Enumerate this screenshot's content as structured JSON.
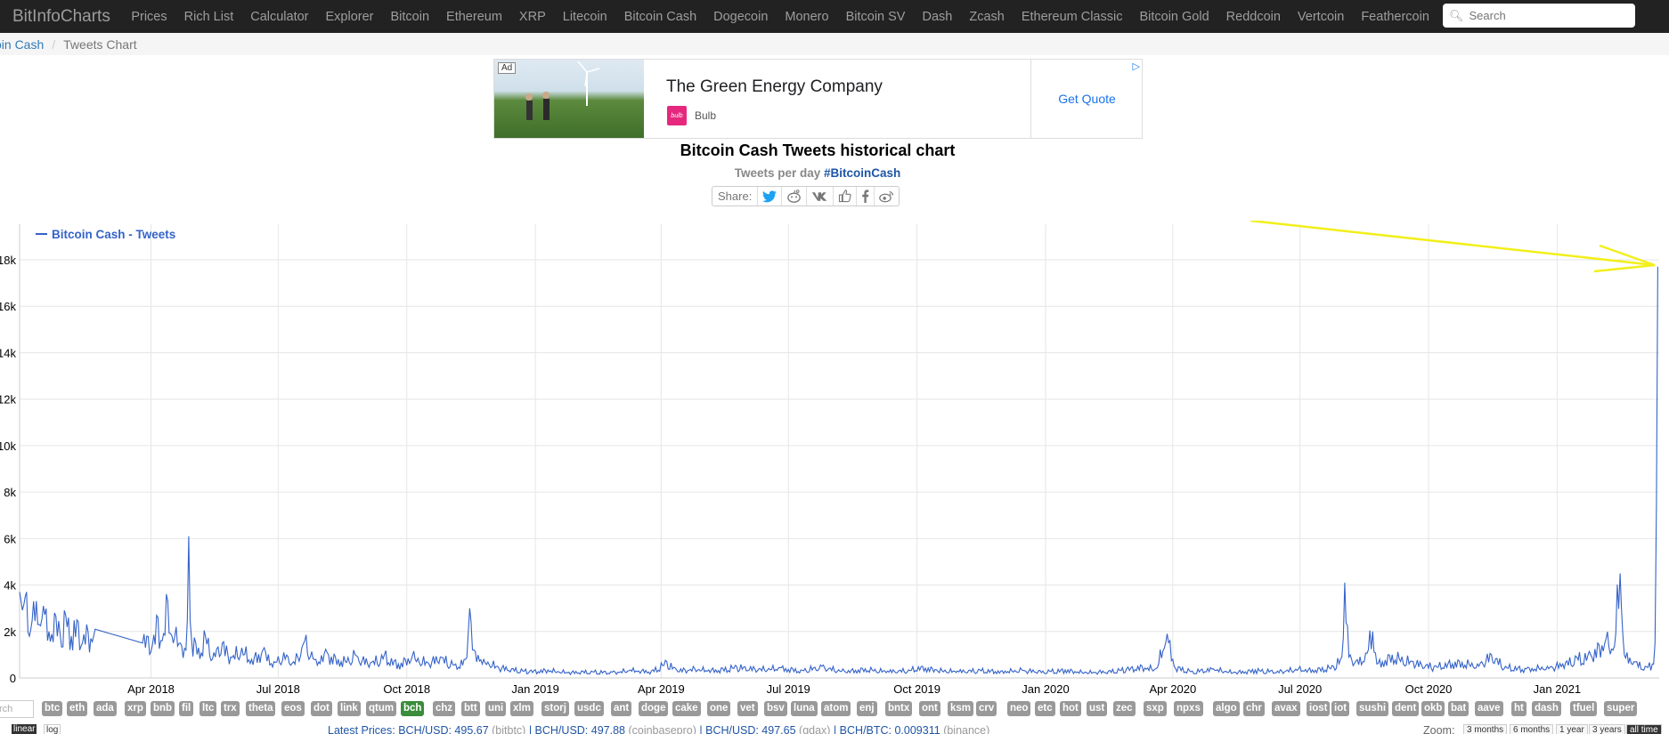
{
  "navbar": {
    "brand": "BitInfoCharts",
    "items": [
      "Prices",
      "Rich List",
      "Calculator",
      "Explorer",
      "Bitcoin",
      "Ethereum",
      "XRP",
      "Litecoin",
      "Bitcoin Cash",
      "Dogecoin",
      "Monero",
      "Bitcoin SV",
      "Dash",
      "Zcash",
      "Ethereum Classic",
      "Bitcoin Gold",
      "Reddcoin",
      "Vertcoin",
      "Feathercoin"
    ],
    "search_placeholder": "Search"
  },
  "breadcrumb": {
    "parent": "oin Cash",
    "current": "Tweets Chart"
  },
  "ad": {
    "tag": "Ad",
    "title": "The Green Energy Company",
    "brand": "Bulb",
    "logo": "bulb",
    "cta": "Get Quote"
  },
  "page": {
    "title": "Bitcoin Cash Tweets historical chart",
    "subtitle": "Tweets per day",
    "hashtag": "#BitcoinCash"
  },
  "share": {
    "label": "Share:",
    "icons": [
      "twitter-icon",
      "reddit-icon",
      "vk-icon",
      "like-icon",
      "facebook-icon",
      "weibo-icon"
    ]
  },
  "chart_data": {
    "type": "line",
    "title": "",
    "xlabel": "",
    "ylabel": "",
    "series": [
      {
        "name": "Bitcoin Cash - Tweets",
        "color": "#3563c9"
      }
    ],
    "legend": "top-left",
    "grid": true,
    "ylim": [
      0,
      18000
    ],
    "y_ticks": [
      0,
      2000,
      4000,
      6000,
      8000,
      10000,
      12000,
      14000,
      16000,
      18000
    ],
    "y_tick_labels": [
      "0",
      "2k",
      "4k",
      "6k",
      "8k",
      "10k",
      "12k",
      "14k",
      "16k",
      "18k"
    ],
    "x_ticks": [
      "2018-04-01",
      "2018-07-01",
      "2018-10-01",
      "2019-01-01",
      "2019-04-01",
      "2019-07-01",
      "2019-10-01",
      "2020-01-01",
      "2020-04-01",
      "2020-07-01",
      "2020-10-01",
      "2021-01-01"
    ],
    "x_tick_labels": [
      "Apr 2018",
      "Jul 2018",
      "Oct 2018",
      "Jan 2019",
      "Apr 2019",
      "Jul 2019",
      "Oct 2019",
      "Jan 2020",
      "Apr 2020",
      "Jul 2020",
      "Oct 2020",
      "Jan 2021"
    ],
    "xlim": [
      "2017-12-28",
      "2021-03-15"
    ],
    "points": [
      [
        "2017-12-28",
        3700
      ],
      [
        "2018-01-01",
        3500
      ],
      [
        "2018-01-04",
        1800
      ],
      [
        "2018-01-07",
        3300
      ],
      [
        "2018-01-10",
        2300
      ],
      [
        "2018-01-14",
        3100
      ],
      [
        "2018-01-18",
        2000
      ],
      [
        "2018-01-22",
        2800
      ],
      [
        "2018-01-26",
        1900
      ],
      [
        "2018-01-30",
        2700
      ],
      [
        "2018-02-03",
        1800
      ],
      [
        "2018-02-07",
        2500
      ],
      [
        "2018-02-11",
        1500
      ],
      [
        "2018-02-14",
        2300
      ],
      [
        "2018-02-17",
        1700
      ],
      [
        "2018-02-20",
        2100
      ],
      [
        "2018-03-26",
        1500
      ],
      [
        "2018-03-29",
        1800
      ],
      [
        "2018-04-02",
        1400
      ],
      [
        "2018-04-06",
        2600
      ],
      [
        "2018-04-09",
        1600
      ],
      [
        "2018-04-13",
        3300
      ],
      [
        "2018-04-16",
        1800
      ],
      [
        "2018-04-19",
        2200
      ],
      [
        "2018-04-22",
        1500
      ],
      [
        "2018-04-26",
        1200
      ],
      [
        "2018-04-28",
        6100
      ],
      [
        "2018-04-30",
        1700
      ],
      [
        "2018-05-05",
        1300
      ],
      [
        "2018-05-10",
        1800
      ],
      [
        "2018-05-16",
        1100
      ],
      [
        "2018-05-22",
        1500
      ],
      [
        "2018-05-28",
        900
      ],
      [
        "2018-06-05",
        1300
      ],
      [
        "2018-06-12",
        800
      ],
      [
        "2018-06-20",
        1200
      ],
      [
        "2018-06-28",
        700
      ],
      [
        "2018-07-05",
        1100
      ],
      [
        "2018-07-12",
        700
      ],
      [
        "2018-07-20",
        1600
      ],
      [
        "2018-07-28",
        800
      ],
      [
        "2018-08-05",
        1100
      ],
      [
        "2018-08-15",
        700
      ],
      [
        "2018-08-25",
        1000
      ],
      [
        "2018-09-05",
        650
      ],
      [
        "2018-09-15",
        1000
      ],
      [
        "2018-09-25",
        600
      ],
      [
        "2018-10-05",
        950
      ],
      [
        "2018-10-15",
        700
      ],
      [
        "2018-10-25",
        900
      ],
      [
        "2018-11-05",
        600
      ],
      [
        "2018-11-12",
        800
      ],
      [
        "2018-11-15",
        3000
      ],
      [
        "2018-11-18",
        1200
      ],
      [
        "2018-11-25",
        800
      ],
      [
        "2018-12-05",
        500
      ],
      [
        "2018-12-15",
        400
      ],
      [
        "2018-12-28",
        300
      ],
      [
        "2019-01-10",
        350
      ],
      [
        "2019-01-25",
        250
      ],
      [
        "2019-02-10",
        300
      ],
      [
        "2019-02-25",
        250
      ],
      [
        "2019-03-10",
        350
      ],
      [
        "2019-03-25",
        300
      ],
      [
        "2019-04-05",
        700
      ],
      [
        "2019-04-12",
        350
      ],
      [
        "2019-04-25",
        400
      ],
      [
        "2019-05-10",
        350
      ],
      [
        "2019-05-25",
        500
      ],
      [
        "2019-06-10",
        400
      ],
      [
        "2019-06-25",
        450
      ],
      [
        "2019-07-10",
        350
      ],
      [
        "2019-07-25",
        500
      ],
      [
        "2019-08-10",
        300
      ],
      [
        "2019-08-25",
        400
      ],
      [
        "2019-09-10",
        300
      ],
      [
        "2019-09-25",
        350
      ],
      [
        "2019-10-05",
        500
      ],
      [
        "2019-10-15",
        350
      ],
      [
        "2019-10-30",
        300
      ],
      [
        "2019-11-15",
        350
      ],
      [
        "2019-11-30",
        300
      ],
      [
        "2019-12-15",
        350
      ],
      [
        "2019-12-30",
        300
      ],
      [
        "2020-01-15",
        350
      ],
      [
        "2020-01-30",
        250
      ],
      [
        "2020-02-15",
        300
      ],
      [
        "2020-02-28",
        400
      ],
      [
        "2020-03-10",
        500
      ],
      [
        "2020-03-20",
        400
      ],
      [
        "2020-03-28",
        1900
      ],
      [
        "2020-04-02",
        500
      ],
      [
        "2020-04-15",
        300
      ],
      [
        "2020-04-30",
        400
      ],
      [
        "2020-05-15",
        250
      ],
      [
        "2020-05-30",
        350
      ],
      [
        "2020-06-15",
        300
      ],
      [
        "2020-06-30",
        400
      ],
      [
        "2020-07-10",
        350
      ],
      [
        "2020-07-25",
        500
      ],
      [
        "2020-07-31",
        900
      ],
      [
        "2020-08-02",
        4100
      ],
      [
        "2020-08-05",
        900
      ],
      [
        "2020-08-15",
        700
      ],
      [
        "2020-08-22",
        2000
      ],
      [
        "2020-08-25",
        600
      ],
      [
        "2020-09-05",
        1000
      ],
      [
        "2020-09-20",
        700
      ],
      [
        "2020-10-05",
        500
      ],
      [
        "2020-10-20",
        700
      ],
      [
        "2020-11-05",
        600
      ],
      [
        "2020-11-15",
        1000
      ],
      [
        "2020-11-25",
        500
      ],
      [
        "2020-12-10",
        400
      ],
      [
        "2020-12-25",
        500
      ],
      [
        "2021-01-05",
        600
      ],
      [
        "2021-01-15",
        900
      ],
      [
        "2021-01-25",
        1000
      ],
      [
        "2021-02-05",
        1700
      ],
      [
        "2021-02-10",
        1200
      ],
      [
        "2021-02-15",
        4500
      ],
      [
        "2021-02-18",
        1000
      ],
      [
        "2021-02-25",
        700
      ],
      [
        "2021-03-05",
        500
      ],
      [
        "2021-03-10",
        600
      ],
      [
        "2021-03-12",
        1500
      ],
      [
        "2021-03-14",
        17700
      ]
    ]
  },
  "coins": [
    "btc",
    "eth",
    "ada",
    "xrp",
    "bnb",
    "fil",
    "ltc",
    "trx",
    "theta",
    "eos",
    "dot",
    "link",
    "qtum",
    "bch",
    "chz",
    "btt",
    "uni",
    "xlm",
    "storj",
    "usdc",
    "ant",
    "doge",
    "cake",
    "one",
    "vet",
    "bsv",
    "luna",
    "atom",
    "enj",
    "bntx",
    "ont",
    "ksm",
    "crv",
    "neo",
    "etc",
    "hot",
    "ust",
    "zec",
    "sxp",
    "npxs",
    "algo",
    "chr",
    "avax",
    "iost",
    "iot",
    "sushi",
    "dent",
    "okb",
    "bat",
    "aave",
    "ht",
    "dash",
    "tfuel",
    "super"
  ],
  "active_coin": "bch",
  "coin_search_placeholder": "rch",
  "scale": {
    "linear": "linear",
    "log": "log"
  },
  "latest_prices": {
    "label": "Latest Prices:",
    "p1": "BCH/USD: 495.67",
    "e1": "(bitbtc)",
    "p2": "BCH/USD: 497.88",
    "e2": "(coinbasepro)",
    "p3": "BCH/USD: 497.65",
    "e3": "(gdax)",
    "p4": "BCH/BTC: 0.009311",
    "e4": "(binance)"
  },
  "zoom": {
    "label": "Zoom:",
    "options": [
      "3 months",
      "6 months",
      "1 year",
      "3 years",
      "all time"
    ],
    "active": "all time"
  },
  "annotation": {
    "arrow_color": "#f2ef1a"
  }
}
